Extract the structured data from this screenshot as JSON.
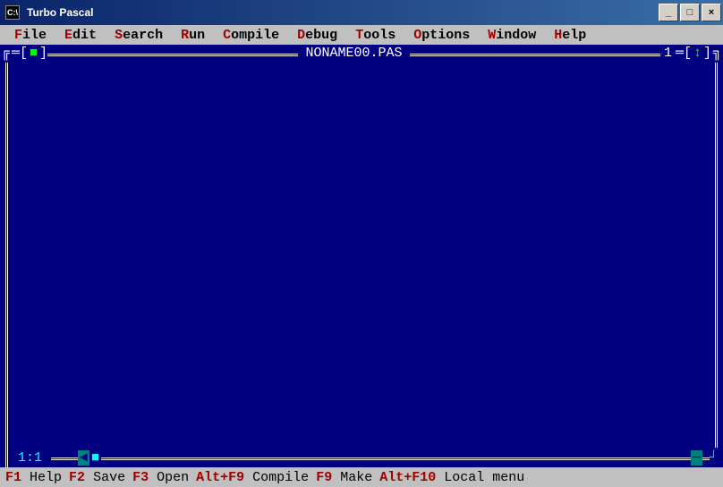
{
  "window": {
    "title": "Turbo Pascal"
  },
  "menu": [
    {
      "hotkey": "F",
      "rest": "ile"
    },
    {
      "hotkey": "E",
      "rest": "dit"
    },
    {
      "hotkey": "S",
      "rest": "earch"
    },
    {
      "hotkey": "R",
      "rest": "un"
    },
    {
      "hotkey": "C",
      "rest": "ompile"
    },
    {
      "hotkey": "D",
      "rest": "ebug"
    },
    {
      "hotkey": "T",
      "rest": "ools"
    },
    {
      "hotkey": "O",
      "rest": "ptions"
    },
    {
      "hotkey": "W",
      "rest": "indow"
    },
    {
      "hotkey": "H",
      "rest": "elp"
    }
  ],
  "editor": {
    "filename": "NONAME00.PAS",
    "window_number": "1",
    "close_glyph": "■",
    "zoom_glyph": "↕",
    "cursor_position": "1:1",
    "scroll_left": "◄",
    "scroll_block": "■",
    "scroll_right": "─",
    "corner": "┘"
  },
  "hotkeys": [
    {
      "key": "F1",
      "label": "Help"
    },
    {
      "key": "F2",
      "label": "Save"
    },
    {
      "key": "F3",
      "label": "Open"
    },
    {
      "key": "Alt+F9",
      "label": "Compile"
    },
    {
      "key": "F9",
      "label": "Make"
    },
    {
      "key": "Alt+F10",
      "label": "Local menu"
    }
  ]
}
